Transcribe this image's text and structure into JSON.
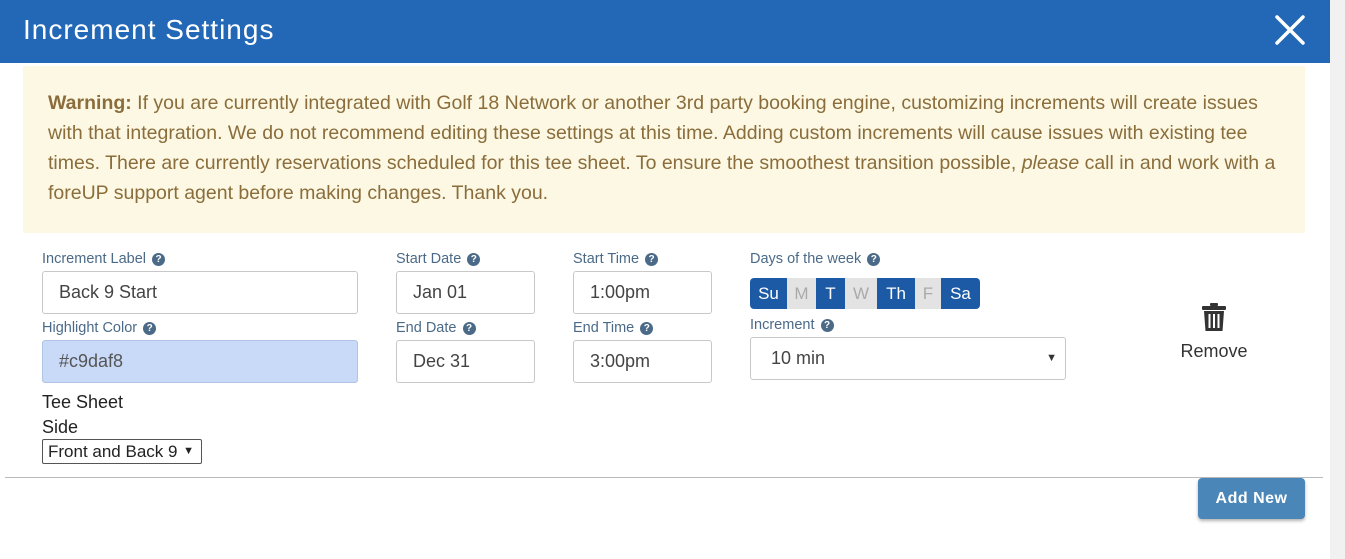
{
  "header": {
    "title": "Increment Settings"
  },
  "warning": {
    "label": "Warning:",
    "text1": " If you are currently integrated with Golf 18 Network or another 3rd party booking engine, customizing increments will create issues with that integration. We do not recommend editing these settings at this time. Adding custom increments will cause issues with existing tee times. There are currently reservations scheduled for this tee sheet. To ensure the smoothest transition possible, ",
    "emphasis": "please",
    "text2": " call in and work with a foreUP support agent before making changes. Thank you."
  },
  "form": {
    "increment_label": {
      "label": "Increment Label",
      "value": "Back 9 Start"
    },
    "highlight_color": {
      "label": "Highlight Color",
      "value": "#c9daf8"
    },
    "start_date": {
      "label": "Start Date",
      "value": "Jan 01"
    },
    "end_date": {
      "label": "End Date",
      "value": "Dec 31"
    },
    "start_time": {
      "label": "Start Time",
      "value": "1:00pm"
    },
    "end_time": {
      "label": "End Time",
      "value": "3:00pm"
    },
    "days": {
      "label": "Days of the week",
      "items": [
        {
          "label": "Su",
          "active": true
        },
        {
          "label": "M",
          "active": false
        },
        {
          "label": "T",
          "active": true
        },
        {
          "label": "W",
          "active": false
        },
        {
          "label": "Th",
          "active": true
        },
        {
          "label": "F",
          "active": false
        },
        {
          "label": "Sa",
          "active": true
        }
      ]
    },
    "increment": {
      "label": "Increment",
      "value": "10 min"
    },
    "tee_sheet_side": {
      "label_line1": "Tee Sheet",
      "label_line2": "Side",
      "value": "Front and Back 9"
    },
    "remove_label": "Remove"
  },
  "footer": {
    "add_new_label": "Add New"
  },
  "colors": {
    "header": "#2268b7",
    "warning_bg": "#fcf8e3",
    "day_active": "#1c5aa6",
    "button": "#4a86b8"
  }
}
